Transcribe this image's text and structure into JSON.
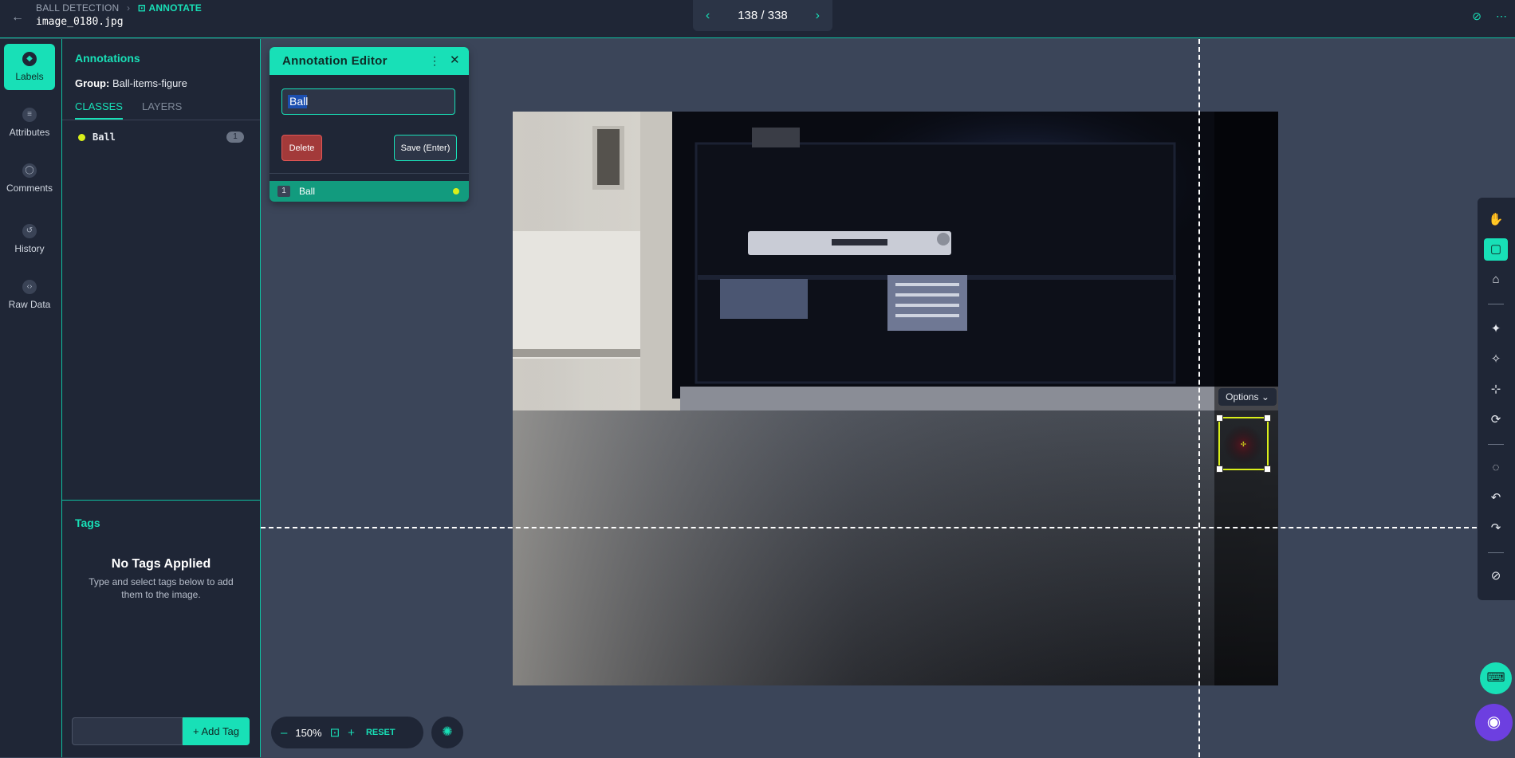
{
  "header": {
    "back_icon": "arrow-left-icon",
    "breadcrumb_project": "BALL DETECTION",
    "breadcrumb_sep": "›",
    "breadcrumb_mode": "ANNOTATE",
    "mode_icon": "annotate-icon",
    "filename": "image_0180.jpg",
    "pager_count": "138 / 338",
    "prev_glyph": "‹",
    "next_glyph": "›",
    "visibility_icon": "eye-off-icon",
    "more_icon": "more-horizontal-icon",
    "visibility_glyph": "⊘",
    "more_glyph": "⋯"
  },
  "sidebar": {
    "items": [
      {
        "label": "Labels",
        "icon": "labels-icon",
        "glyph": "◆",
        "active": true
      },
      {
        "label": "Attributes",
        "icon": "attributes-icon",
        "glyph": "≡",
        "active": false
      },
      {
        "label": "Comments",
        "icon": "comments-icon",
        "glyph": "◯",
        "active": false
      },
      {
        "label": "History",
        "icon": "history-icon",
        "glyph": "↺",
        "active": false
      },
      {
        "label": "Raw Data",
        "icon": "code-icon",
        "glyph": "‹›",
        "active": false
      }
    ]
  },
  "annotations_panel": {
    "title": "Annotations",
    "group_label": "Group:",
    "group_value": "Ball-items-figure",
    "tabs": [
      {
        "label": "CLASSES",
        "active": true
      },
      {
        "label": "LAYERS",
        "active": false
      }
    ],
    "classes": [
      {
        "name": "Ball",
        "count": "1",
        "color": "#d9ef1a"
      }
    ]
  },
  "tags": {
    "title": "Tags",
    "empty_title": "No Tags Applied",
    "empty_subtitle": "Type and select tags below to add them to the image.",
    "input_value": "",
    "add_button": "+ Add Tag"
  },
  "editor": {
    "title": "Annotation Editor",
    "more_glyph": "⋮",
    "close_glyph": "✕",
    "class_input": "Ball",
    "delete_button": "Delete",
    "save_button": "Save (Enter)",
    "annotations": [
      {
        "index": "1",
        "label": "Ball",
        "color": "#d9ef1a"
      }
    ]
  },
  "canvas": {
    "options_label": "Options ⌄",
    "bbox_color": "#d9ef1a",
    "center_glyph": "✣"
  },
  "zoom": {
    "minus": "–",
    "value": "150%",
    "lock_glyph": "⊡",
    "plus": "+",
    "reset": "RESET",
    "extra_glyph": "✺"
  },
  "tools": [
    {
      "name": "pan-tool",
      "icon": "hand-icon",
      "glyph": "✋",
      "active": false
    },
    {
      "name": "bbox-tool",
      "icon": "bounding-box-icon",
      "glyph": "▢",
      "active": true
    },
    {
      "name": "polygon-tool",
      "icon": "polygon-icon",
      "glyph": "⌂",
      "active": false
    },
    {
      "name": "magic-tool",
      "icon": "magic-wand-icon",
      "glyph": "✦",
      "active": false
    },
    {
      "name": "smart-tool",
      "icon": "smart-brush-icon",
      "glyph": "✧",
      "active": false
    },
    {
      "name": "keypoint-tool",
      "icon": "keypoint-icon",
      "glyph": "⊹",
      "active": false
    },
    {
      "name": "repeat-tool",
      "icon": "repeat-icon",
      "glyph": "⟳",
      "active": false
    },
    {
      "name": "comment-tool",
      "icon": "comment-icon",
      "glyph": "◌",
      "active": false
    },
    {
      "name": "undo-tool",
      "icon": "undo-icon",
      "glyph": "↶",
      "active": false
    },
    {
      "name": "redo-tool",
      "icon": "redo-icon",
      "glyph": "↷",
      "active": false
    },
    {
      "name": "hide-tool",
      "icon": "hide-icon",
      "glyph": "⊘",
      "active": false
    }
  ],
  "floating": {
    "keyboard_glyph": "⌨",
    "chat_glyph": "◉"
  },
  "colors": {
    "accent": "#18e0b7",
    "panel_bg": "#1f2636",
    "canvas_bg": "#3b4559",
    "danger": "#a33a3a",
    "class_ball": "#d9ef1a"
  }
}
